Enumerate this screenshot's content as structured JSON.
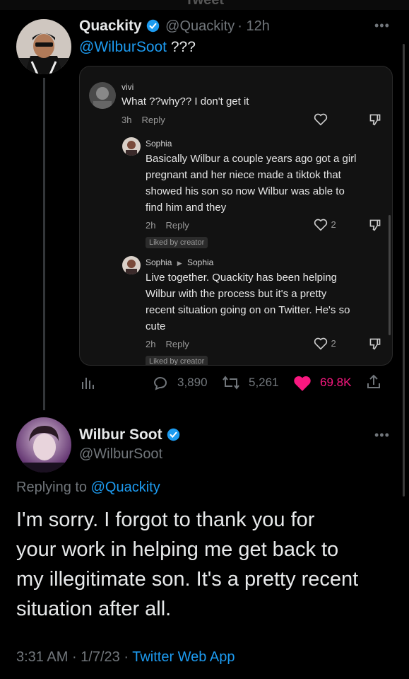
{
  "topbar": {
    "title": "Tweet"
  },
  "tweet1": {
    "name": "Quackity",
    "handle": "@Quackity",
    "time": "· 12h",
    "mention": "@WilburSoot",
    "text": "???",
    "metrics": {
      "replies": "3,890",
      "retweets": "5,261",
      "likes": "69.8K"
    },
    "liked": true
  },
  "tiktok": {
    "comments": [
      {
        "user": "vivi",
        "text": "What ??why?? I don't get it",
        "time": "3h",
        "reply_label": "Reply"
      },
      {
        "user": "Sophia",
        "text_lines": [
          "Basically Wilbur a couple years ago got a girl",
          "pregnant and her niece made a tiktok that",
          "showed his son so now Wilbur was able to",
          "find him and they"
        ],
        "time": "2h",
        "reply_label": "Reply",
        "likes": "2",
        "badge": "Liked by creator"
      },
      {
        "user": "Sophia",
        "reply_to": "Sophia",
        "text_lines": [
          "Live together. Quackity has been helping",
          "Wilbur with the process but it's a pretty",
          "recent situation going on on Twitter. He's so",
          "cute"
        ],
        "time": "2h",
        "reply_label": "Reply",
        "likes": "2",
        "badge": "Liked by creator"
      }
    ]
  },
  "tweet2": {
    "name": "Wilbur Soot",
    "handle": "@WilburSoot",
    "replying_prefix": "Replying to",
    "replying_to": "@Quackity",
    "text_lines": [
      "I'm sorry. I forgot to thank you for",
      "your work in helping me get back to",
      "my illegitimate son. It's a pretty recent",
      "situation after all."
    ],
    "time": "3:31 AM",
    "date": "1/7/23",
    "source": "Twitter Web App"
  },
  "colors": {
    "accent": "#1d9bf0",
    "like": "#f91880",
    "bg": "#000000"
  }
}
